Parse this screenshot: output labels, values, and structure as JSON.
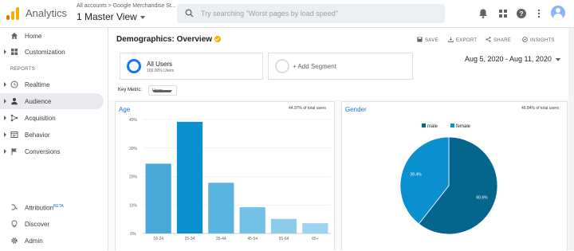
{
  "header": {
    "app_name": "Analytics",
    "breadcrumb": "All accounts > Google Merchandise St...",
    "view_name": "1 Master View",
    "search_placeholder": "Try searching \"Worst pages by load speed\""
  },
  "sidebar": {
    "top_items": [
      {
        "label": "Home",
        "icon": "home-icon"
      },
      {
        "label": "Customization",
        "icon": "grid-icon"
      }
    ],
    "section_label": "REPORTS",
    "report_items": [
      {
        "label": "Realtime",
        "icon": "clock-icon"
      },
      {
        "label": "Audience",
        "icon": "person-icon"
      },
      {
        "label": "Acquisition",
        "icon": "acquisition-icon"
      },
      {
        "label": "Behavior",
        "icon": "behavior-icon"
      },
      {
        "label": "Conversions",
        "icon": "flag-icon"
      }
    ],
    "bottom_items": [
      {
        "label": "Attribution",
        "badge": "BETA",
        "icon": "attribution-icon"
      },
      {
        "label": "Discover",
        "icon": "lightbulb-icon"
      },
      {
        "label": "Admin",
        "icon": "gear-icon"
      }
    ],
    "active_item": "Audience"
  },
  "main": {
    "title": "Demographics: Overview",
    "actions": {
      "save": "SAVE",
      "export": "EXPORT",
      "share": "SHARE",
      "insights": "INSIGHTS"
    },
    "segment": {
      "name": "All Users",
      "sub": "100.00% Users"
    },
    "add_segment": "+ Add Segment",
    "date_range": "Aug 5, 2020 - Aug 11, 2020",
    "key_metric_label": "Key Metric:",
    "key_metric_value": "Users"
  },
  "colors": {
    "accent": "#1a73e8",
    "male": "#05668d",
    "female": "#0a8fcf"
  },
  "age_panel": {
    "title": "Age",
    "pct_text": "44.97% of total users"
  },
  "gender_panel": {
    "title": "Gender",
    "pct_text": "46.84% of total users"
  },
  "chart_data": [
    {
      "type": "bar",
      "title": "Age",
      "categories": [
        "18-24",
        "25-34",
        "35-44",
        "45-54",
        "55-64",
        "65+"
      ],
      "values": [
        24.5,
        39.2,
        17.8,
        9.2,
        5.1,
        3.6
      ],
      "yticks": [
        "0%",
        "10%",
        "20%",
        "30%",
        "40%"
      ],
      "ylim": [
        0,
        40
      ],
      "colors": [
        "#4aa8d8",
        "#0a8fcf",
        "#5bb4e0",
        "#72c0e6",
        "#8ccbea",
        "#9cd3ef"
      ]
    },
    {
      "type": "pie",
      "title": "Gender",
      "labels": [
        "male",
        "female"
      ],
      "values": [
        60.6,
        39.4
      ],
      "value_labels": [
        "60.6%",
        "39.4%"
      ],
      "colors": [
        "#05668d",
        "#0a8fcf"
      ],
      "legend_position": "top"
    }
  ]
}
